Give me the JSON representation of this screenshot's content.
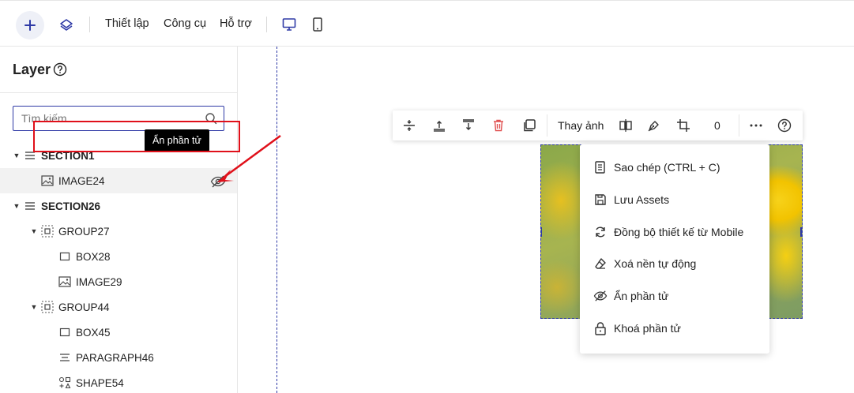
{
  "toolbar": {
    "menu": [
      "Thiết lập",
      "Công cụ",
      "Hỗ trợ"
    ]
  },
  "panel": {
    "title": "Layer",
    "search_placeholder": "Tìm kiếm..."
  },
  "tree": [
    {
      "label": "SECTION1",
      "icon": "section-icon",
      "bold": true,
      "caret": "▼"
    },
    {
      "label": "IMAGE24",
      "icon": "image-icon",
      "bold": false,
      "caret": "",
      "selected": true
    },
    {
      "label": "SECTION26",
      "icon": "section-icon",
      "bold": true,
      "caret": "▼"
    },
    {
      "label": "GROUP27",
      "icon": "group-icon",
      "bold": false,
      "caret": "▼"
    },
    {
      "label": "BOX28",
      "icon": "box-icon",
      "bold": false,
      "caret": ""
    },
    {
      "label": "IMAGE29",
      "icon": "image-icon",
      "bold": false,
      "caret": ""
    },
    {
      "label": "GROUP44",
      "icon": "group-icon",
      "bold": false,
      "caret": "▼"
    },
    {
      "label": "BOX45",
      "icon": "box-icon",
      "bold": false,
      "caret": ""
    },
    {
      "label": "PARAGRAPH46",
      "icon": "paragraph-icon",
      "bold": false,
      "caret": ""
    },
    {
      "label": "SHAPE54",
      "icon": "shape-icon",
      "bold": false,
      "caret": ""
    }
  ],
  "tooltip": "Ẩn phần tử",
  "element_bar": {
    "replace_image": "Thay ảnh",
    "counter": "0"
  },
  "context_menu": [
    {
      "label": "Sao chép (CTRL + C)",
      "icon": "copy-icon"
    },
    {
      "label": "Lưu Assets",
      "icon": "save-icon"
    },
    {
      "label": "Đồng bộ thiết kế từ Mobile",
      "icon": "sync-icon"
    },
    {
      "label": "Xoá nền tự động",
      "icon": "eraser-icon"
    },
    {
      "label": "Ẩn phần tử",
      "icon": "eye-off-icon"
    },
    {
      "label": "Khoá phần tử",
      "icon": "lock-icon"
    }
  ],
  "colors": {
    "accent": "#2f3aa6",
    "highlight": "#e0101a",
    "delete": "#e05050"
  }
}
